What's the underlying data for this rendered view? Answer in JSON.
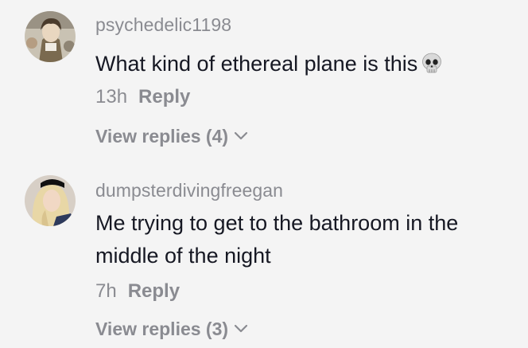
{
  "comments": [
    {
      "username": "psychedelic1198",
      "text": "What kind of ethereal plane is this",
      "emoji": "skull-emoji",
      "time": "13h",
      "reply_label": "Reply",
      "view_replies": "View replies (4)"
    },
    {
      "username": "dumpsterdivingfreegan",
      "text": "Me trying to get to the bathroom in the middle of the night",
      "time": "7h",
      "reply_label": "Reply",
      "view_replies": "View replies (3)"
    }
  ],
  "colors": {
    "background": "#f4f4f4",
    "username": "#8a8b91",
    "text": "#161823",
    "meta": "#8a8b91"
  }
}
